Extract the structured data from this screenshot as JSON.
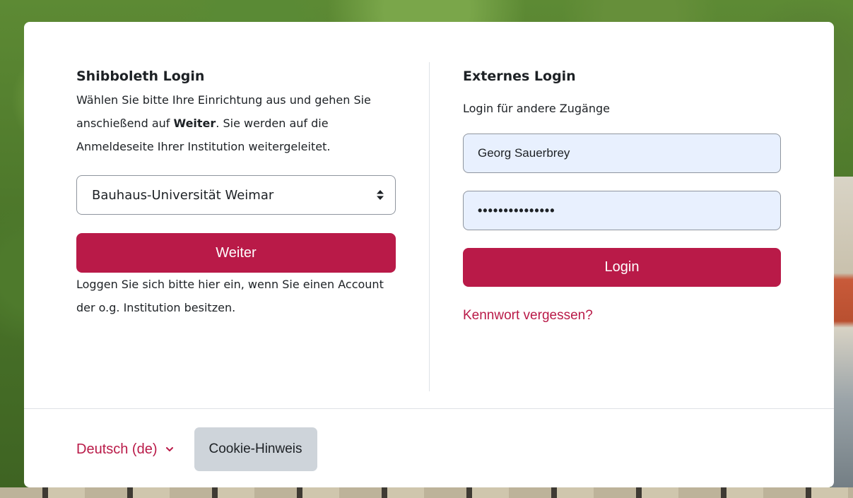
{
  "colors": {
    "primary": "#b91a48",
    "autofill": "#e8f0fe",
    "secondary": "#ced4da"
  },
  "shibboleth": {
    "title": "Shibboleth Login",
    "intro_part1": "Wählen Sie bitte Ihre Einrichtung aus und gehen Sie anschießend auf ",
    "intro_bold": "Weiter",
    "intro_part2": ". Sie werden auf die Anmeldeseite Ihrer Institution weitergeleitet.",
    "institution_selected": "Bauhaus-Universität Weimar",
    "continue_label": "Weiter",
    "after_text": "Loggen Sie sich bitte hier ein, wenn Sie einen Account der o.g. Institution besitzen."
  },
  "external": {
    "title": "Externes Login",
    "subtitle": "Login für andere Zugänge",
    "username_value": "Georg Sauerbrey",
    "password_mask": "•••••••••••••••",
    "login_label": "Login",
    "forgot_label": "Kennwort vergessen?"
  },
  "footer": {
    "language": "Deutsch (de)",
    "cookie_label": "Cookie-Hinweis"
  },
  "icons": {
    "select_arrow": "sort-arrows-icon",
    "language_chevron": "chevron-down-icon"
  }
}
